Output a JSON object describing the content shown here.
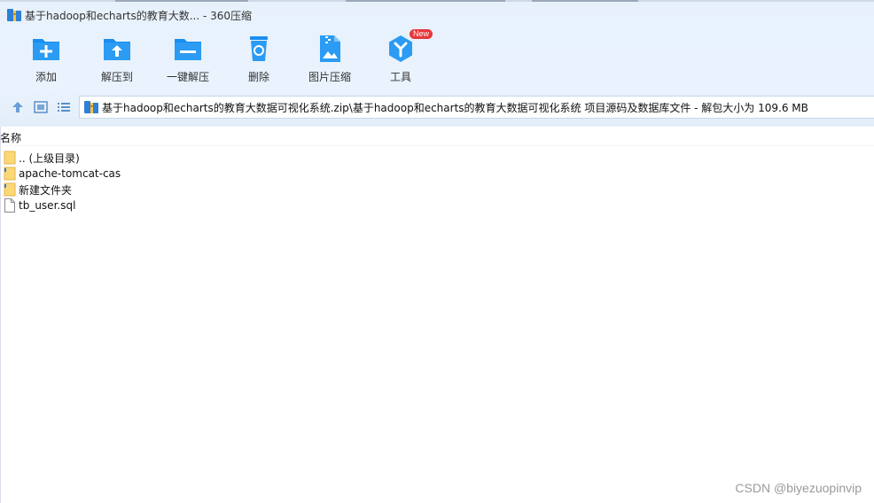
{
  "window": {
    "title": "基于hadoop和echarts的教育大数... - 360压缩",
    "app_icon": "archive-icon"
  },
  "toolbar": {
    "items": [
      {
        "label": "添加",
        "icon": "add-icon"
      },
      {
        "label": "解压到",
        "icon": "extract-to-icon"
      },
      {
        "label": "一键解压",
        "icon": "one-click-extract-icon"
      },
      {
        "label": "删除",
        "icon": "delete-icon"
      },
      {
        "label": "图片压缩",
        "icon": "image-compress-icon"
      },
      {
        "label": "工具",
        "icon": "tools-icon",
        "badge": "New"
      }
    ],
    "accent": "#1a8ef0"
  },
  "nav": {
    "up_icon": "up-arrow-icon",
    "thumbnail_icon": "thumbnail-view-icon",
    "list_icon": "list-view-icon",
    "path": "基于hadoop和echarts的教育大数据可视化系统.zip\\基于hadoop和echarts的教育大数据可视化系统 项目源码及数据库文件 - 解包大小为 109.6 MB"
  },
  "list": {
    "column_name": "名称",
    "rows": [
      {
        "name": ".. (上级目录)",
        "icon": "folder-icon"
      },
      {
        "name": "apache-tomcat-cas",
        "icon": "folder-icon"
      },
      {
        "name": "新建文件夹",
        "icon": "folder-icon"
      },
      {
        "name": "tb_user.sql",
        "icon": "file-icon"
      }
    ]
  },
  "watermark": "CSDN @biyezuopinvip"
}
